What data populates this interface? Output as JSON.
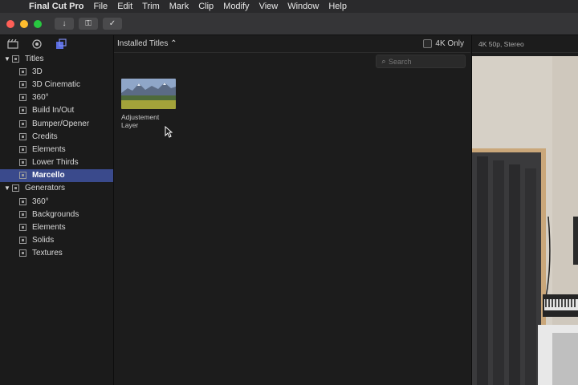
{
  "menubar": {
    "app_name": "Final Cut Pro",
    "items": [
      "File",
      "Edit",
      "Trim",
      "Mark",
      "Clip",
      "Modify",
      "View",
      "Window",
      "Help"
    ]
  },
  "toolbar": {
    "buttons": [
      "import-icon",
      "key-icon",
      "checkmark-icon"
    ]
  },
  "sidebar": {
    "tabs": [
      "library-icon",
      "photos-audio-icon",
      "titles-generators-icon"
    ],
    "titles_label": "Titles",
    "title_items": [
      "3D",
      "3D Cinematic",
      "360°",
      "Build In/Out",
      "Bumper/Opener",
      "Credits",
      "Elements",
      "Lower Thirds",
      "Marcello"
    ],
    "selected_item": "Marcello",
    "generators_label": "Generators",
    "generator_items": [
      "360°",
      "Backgrounds",
      "Elements",
      "Solids",
      "Textures"
    ]
  },
  "browser": {
    "filter_label": "Installed Titles",
    "fourk_label": "4K Only",
    "search_placeholder": "Search",
    "clip": {
      "label_line1": "Adjustement",
      "label_line2": "Layer"
    }
  },
  "viewer": {
    "format_label": "4K 50p, Stereo"
  },
  "colors": {
    "selection": "#3a4a8c",
    "close": "#ff5f57",
    "minimize": "#febc2e",
    "zoom": "#28c840"
  }
}
